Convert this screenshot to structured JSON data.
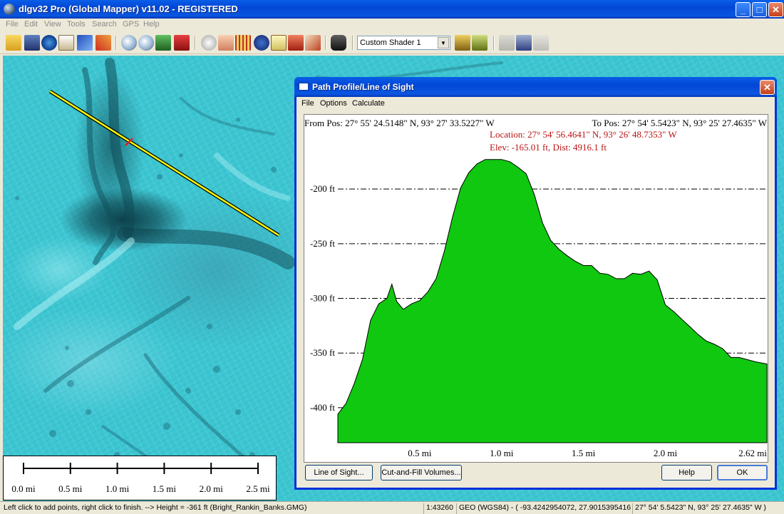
{
  "window": {
    "title": "dlgv32 Pro (Global Mapper) v11.02 - REGISTERED",
    "minimize": "_",
    "maximize": "□",
    "close": "✕"
  },
  "menu": [
    "File",
    "Edit",
    "View",
    "Tools",
    "Search",
    "GPS",
    "Help"
  ],
  "toolbar": {
    "shader_value": "Custom Shader 1",
    "icons": [
      "open-icon",
      "save-icon",
      "globe-icon",
      "layers-icon",
      "tools-icon",
      "zoom-in-icon",
      "zoom-out-icon",
      "full-view-icon",
      "home-icon",
      "zoom-tool-icon",
      "pan-hand-icon",
      "measure-icon",
      "info-icon",
      "path-profile-icon",
      "3d-icon",
      "draw-icon",
      "binoculars-icon",
      "shader-options-icon",
      "3d-view-icon",
      "feature-info-icon",
      "digitizer-icon",
      "gps-icon"
    ]
  },
  "colors": {
    "profile_fill": "#10c810",
    "location_text": "#b81414",
    "title_blue": "#0a5ee8",
    "map_water": "#3cc6d2",
    "profile_line": "#ffff00"
  },
  "scalebar": {
    "labels": [
      "0.0 mi",
      "0.5 mi",
      "1.0 mi",
      "1.5 mi",
      "2.0 mi",
      "2.5 mi"
    ]
  },
  "status": {
    "hint": "Left click to add points, right click to finish. --> Height = -361 ft (Bright_Rankin_Banks.GMG)",
    "scale": "1:43260",
    "projection": "GEO (WGS84) - ( -93.4242954072, 27.9015395416 )",
    "position": "27° 54' 5.5423\" N, 93° 25' 27.4635\" W )"
  },
  "dialog": {
    "title": "Path Profile/Line of Sight",
    "close": "✕",
    "menu": [
      "File",
      "Options",
      "Calculate"
    ],
    "from_pos": "From Pos: 27° 55' 24.5148\" N, 93° 27' 33.5227\" W",
    "to_pos": "To Pos: 27° 54' 5.5423\" N, 93° 25' 27.4635\" W",
    "location": "Location: 27° 54' 56.4641\" N, 93° 26' 48.7353\" W",
    "elev": "Elev: -165.01 ft, Dist: 4916.1 ft",
    "buttons": {
      "line_of_sight": "Line of Sight...",
      "cut_fill": "Cut-and-Fill Volumes...",
      "help": "Help",
      "ok": "OK"
    }
  },
  "chart_data": {
    "type": "area",
    "xlabel": "",
    "ylabel": "",
    "x_unit": "mi",
    "y_unit": "ft",
    "xlim": [
      0,
      2.62
    ],
    "ylim": [
      -432,
      -166
    ],
    "x_ticks": [
      {
        "value": 0.5,
        "label": "0.5 mi"
      },
      {
        "value": 1.0,
        "label": "1.0 mi"
      },
      {
        "value": 1.5,
        "label": "1.5 mi"
      },
      {
        "value": 2.0,
        "label": "2.0 mi"
      },
      {
        "value": 2.62,
        "label": "2.62 mi"
      }
    ],
    "y_ticks": [
      {
        "value": -200,
        "label": "-200 ft"
      },
      {
        "value": -250,
        "label": "-250 ft"
      },
      {
        "value": -300,
        "label": "-300 ft"
      },
      {
        "value": -350,
        "label": "-350 ft"
      },
      {
        "value": -400,
        "label": "-400 ft"
      }
    ],
    "grid": "horizontal dash-dot",
    "x": [
      0.0,
      0.05,
      0.1,
      0.15,
      0.2,
      0.25,
      0.3,
      0.33,
      0.36,
      0.4,
      0.45,
      0.5,
      0.55,
      0.6,
      0.65,
      0.7,
      0.75,
      0.8,
      0.85,
      0.9,
      0.95,
      1.0,
      1.05,
      1.1,
      1.15,
      1.2,
      1.25,
      1.3,
      1.35,
      1.4,
      1.45,
      1.5,
      1.55,
      1.6,
      1.65,
      1.7,
      1.75,
      1.8,
      1.85,
      1.9,
      1.95,
      2.0,
      2.05,
      2.1,
      2.15,
      2.2,
      2.25,
      2.3,
      2.35,
      2.4,
      2.45,
      2.5,
      2.55,
      2.62
    ],
    "y": [
      -406,
      -396,
      -378,
      -356,
      -320,
      -305,
      -300,
      -287,
      -303,
      -310,
      -305,
      -302,
      -294,
      -282,
      -257,
      -226,
      -199,
      -185,
      -177,
      -173,
      -173,
      -173,
      -175,
      -180,
      -186,
      -205,
      -231,
      -247,
      -255,
      -261,
      -266,
      -270,
      -270,
      -277,
      -278,
      -282,
      -282,
      -277,
      -278,
      -275,
      -283,
      -306,
      -312,
      -319,
      -326,
      -333,
      -339,
      -342,
      -346,
      -354,
      -354,
      -356,
      -358,
      -360
    ]
  }
}
